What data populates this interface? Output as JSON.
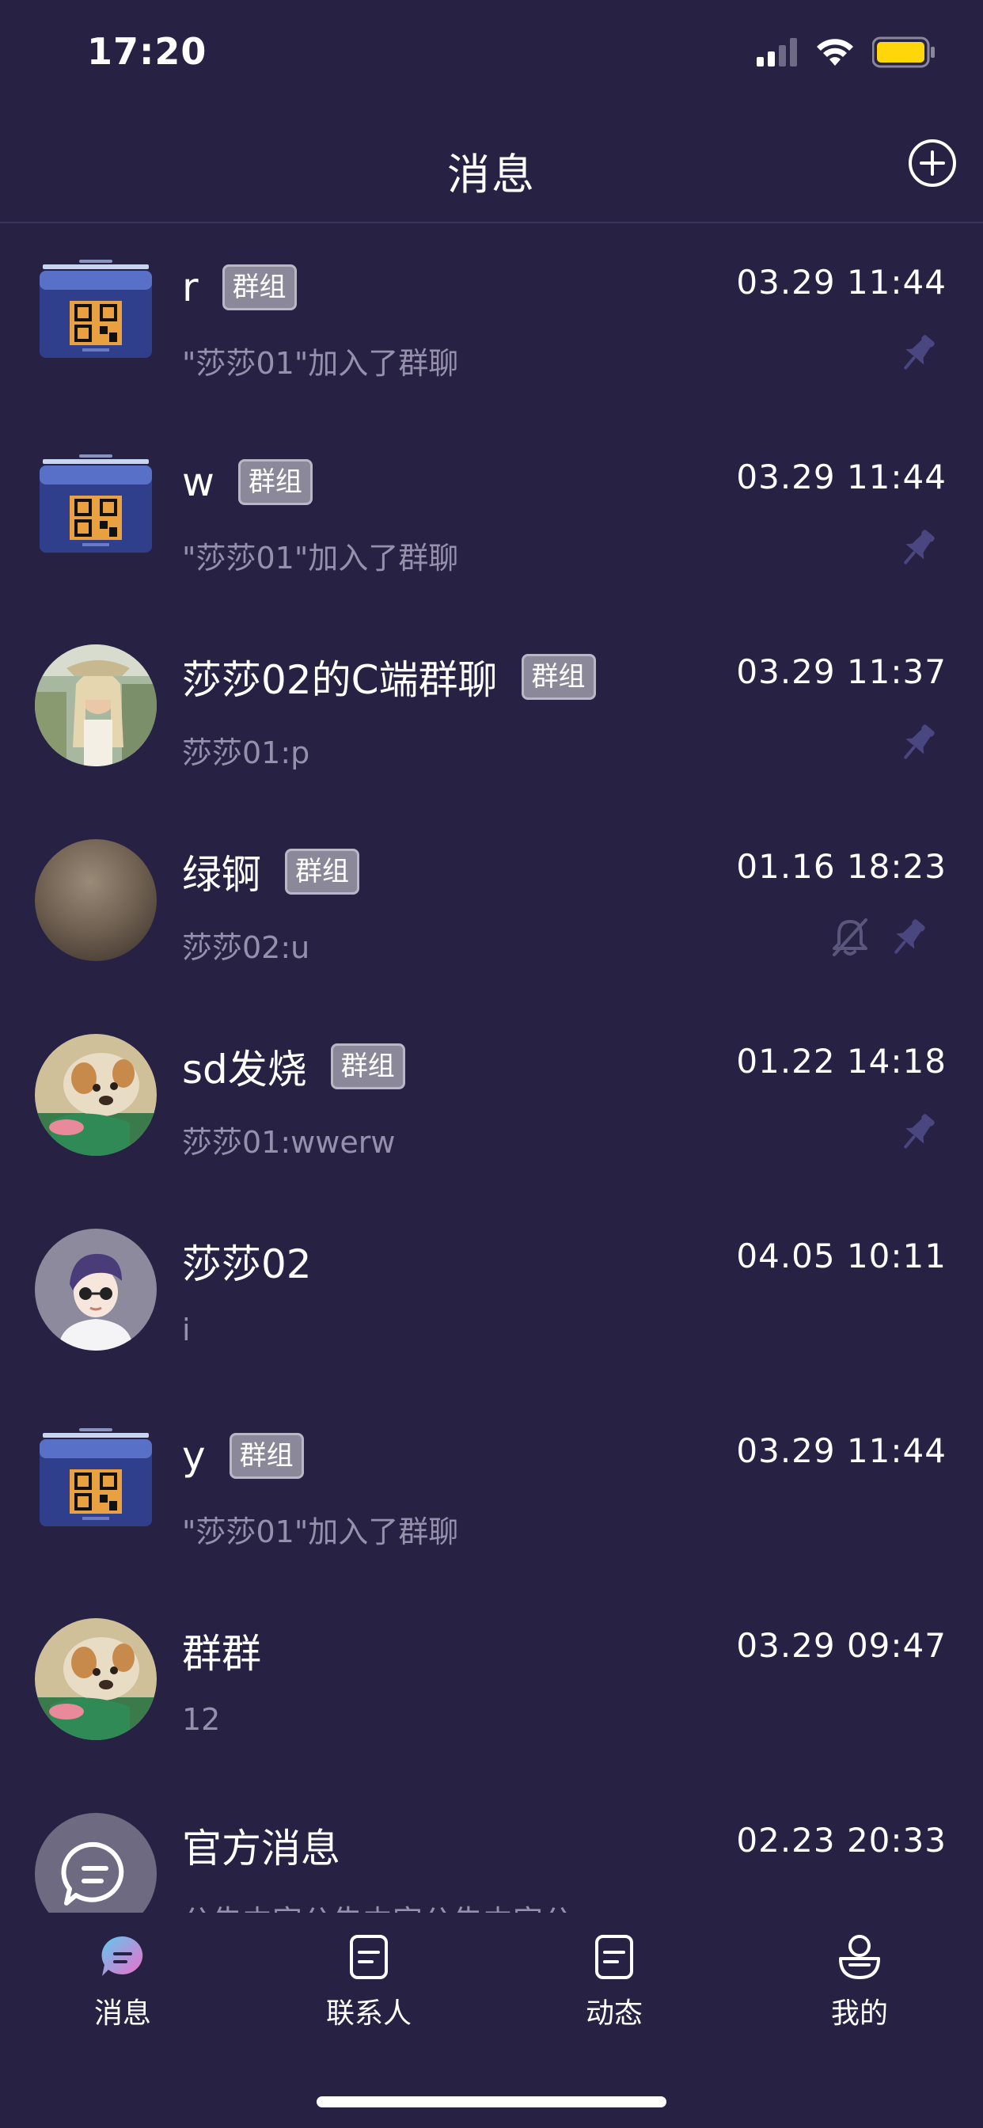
{
  "status_bar": {
    "time": "17:20",
    "signal_icon": "signal-icon",
    "wifi_icon": "wifi-icon",
    "battery_icon": "battery-icon",
    "battery_color": "#FFD60A"
  },
  "header": {
    "title": "消息",
    "add_icon": "plus-circle-icon"
  },
  "conversations": [
    {
      "title": "r",
      "tag": "群组",
      "time": "03.29 11:44",
      "preview": "\"莎莎01\"加入了群聊",
      "pinned": true,
      "muted": false,
      "avatar": "qr-poster"
    },
    {
      "title": "w",
      "tag": "群组",
      "time": "03.29 11:44",
      "preview": "\"莎莎01\"加入了群聊",
      "pinned": true,
      "muted": false,
      "avatar": "qr-poster"
    },
    {
      "title": "莎莎02的C端群聊",
      "tag": "群组",
      "time": "03.29 11:37",
      "preview": "莎莎01:p",
      "pinned": true,
      "muted": false,
      "avatar": "girl-photo"
    },
    {
      "title": "绿锕",
      "tag": "群组",
      "time": "01.16 18:23",
      "preview": "莎莎02:u",
      "pinned": true,
      "muted": true,
      "avatar": "blurred-photo"
    },
    {
      "title": "sd发烧",
      "tag": "群组",
      "time": "01.22 14:18",
      "preview": "莎莎01:wwerw",
      "pinned": true,
      "muted": false,
      "avatar": "dog-photo"
    },
    {
      "title": "莎莎02",
      "tag": "",
      "time": "04.05 10:11",
      "preview": "i",
      "pinned": false,
      "muted": false,
      "avatar": "cartoon-avatar"
    },
    {
      "title": "y",
      "tag": "群组",
      "time": "03.29 11:44",
      "preview": "\"莎莎01\"加入了群聊",
      "pinned": false,
      "muted": false,
      "avatar": "qr-poster"
    },
    {
      "title": "群群",
      "tag": "",
      "time": "03.29 09:47",
      "preview": "12",
      "pinned": false,
      "muted": false,
      "avatar": "dog-photo"
    },
    {
      "title": "官方消息",
      "tag": "",
      "time": "02.23 20:33",
      "preview": "公告内容公告内容公告内容公",
      "pinned": false,
      "muted": false,
      "avatar": "official-chat-icon"
    }
  ],
  "tabs": [
    {
      "label": "消息",
      "icon": "message-icon",
      "active": true
    },
    {
      "label": "联系人",
      "icon": "contacts-icon",
      "active": false
    },
    {
      "label": "动态",
      "icon": "moments-icon",
      "active": false
    },
    {
      "label": "我的",
      "icon": "profile-icon",
      "active": false
    }
  ],
  "colors": {
    "background": "#272243",
    "preview_text": "#9690AD",
    "pin_icon": "#4A4680",
    "accent_gradient_start": "#5ec8f0",
    "accent_gradient_end": "#f06ec8"
  }
}
